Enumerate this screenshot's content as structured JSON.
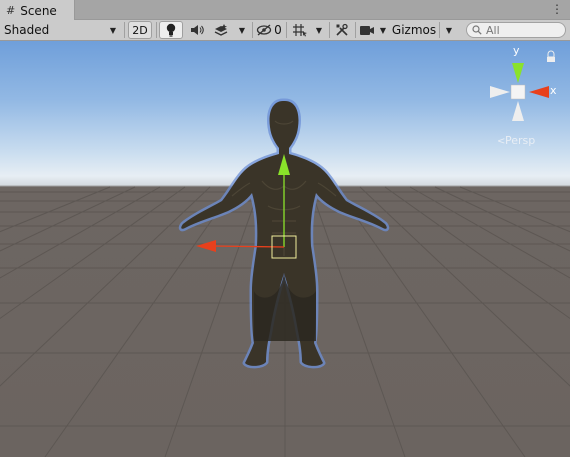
{
  "tab": {
    "icon": "grid-hash-icon",
    "label": "Scene"
  },
  "toolbar": {
    "shading_mode": "Shaded",
    "mode_2d": "2D",
    "hidden_count": "0",
    "gizmos_label": "Gizmos",
    "search_placeholder": "All"
  },
  "orientation_gizmo": {
    "y_label": "y",
    "x_label": "x",
    "projection_label": "Persp"
  },
  "colors": {
    "x_axis": "#e8401c",
    "y_axis": "#8ae22a",
    "toolbar_bg": "#cbcbcb",
    "tab_bg": "#a5a5a5"
  }
}
